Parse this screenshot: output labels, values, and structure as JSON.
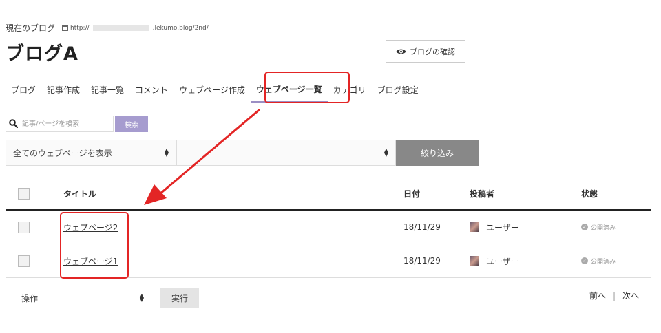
{
  "header": {
    "crumb_label": "現在のブログ",
    "url_prefix": "http://",
    "url_suffix": ".lekumo.blog/2nd/",
    "blog_title": "ブログA",
    "preview_label": "ブログの確認"
  },
  "nav": {
    "tabs": [
      {
        "label": "ブログ"
      },
      {
        "label": "記事作成"
      },
      {
        "label": "記事一覧"
      },
      {
        "label": "コメント"
      },
      {
        "label": "ウェブページ作成"
      },
      {
        "label": "ウェブページ一覧"
      },
      {
        "label": "カテゴリ"
      },
      {
        "label": "ブログ設定"
      }
    ],
    "active_index": 5
  },
  "search": {
    "placeholder": "記事/ページを検索",
    "button_label": "検索"
  },
  "filters": {
    "select1_value": "全てのウェブページを表示",
    "select2_value": "",
    "filter_button_label": "絞り込み"
  },
  "table": {
    "headers": {
      "title": "タイトル",
      "date": "日付",
      "author": "投稿者",
      "status": "状態"
    },
    "rows": [
      {
        "title": "ウェブページ2",
        "date": "18/11/29",
        "author": "ユーザー",
        "status": "公開済み"
      },
      {
        "title": "ウェブページ1",
        "date": "18/11/29",
        "author": "ユーザー",
        "status": "公開済み"
      }
    ]
  },
  "bottom": {
    "action_select_value": "操作",
    "execute_label": "実行"
  },
  "pager": {
    "prev_label": "前へ",
    "separator": "|",
    "next_label": "次へ"
  },
  "colors": {
    "accent": "#a69ccf",
    "highlight": "#e32525",
    "filter_button": "#888888"
  }
}
